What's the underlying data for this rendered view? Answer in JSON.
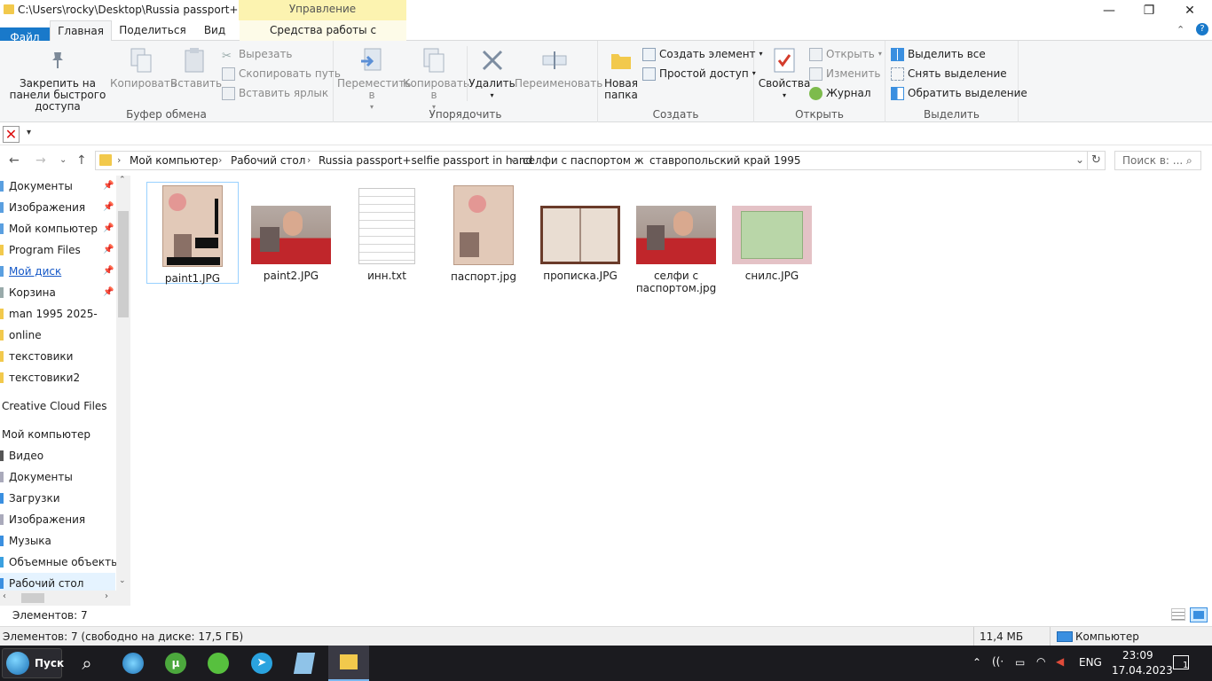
{
  "window": {
    "title": "C:\\Users\\rocky\\Desktop\\Russia passport+self...",
    "context_tab_header": "Управление",
    "minimize": "—",
    "maximize": "❐",
    "close": "✕"
  },
  "tabs": [
    {
      "label": "Файл"
    },
    {
      "label": "Главная"
    },
    {
      "label": "Поделиться"
    },
    {
      "label": "Вид"
    },
    {
      "label": "Средства работы с рисунками"
    }
  ],
  "ribbon": {
    "clipboard": {
      "label": "Буфер обмена",
      "pin": "Закрепить на панели быстрого доступа",
      "copy": "Копировать",
      "paste": "Вставить",
      "cut": "Вырезать",
      "copy_path": "Скопировать путь",
      "paste_shortcut": "Вставить ярлык"
    },
    "organize": {
      "label": "Упорядочить",
      "move_to": "Переместить в",
      "copy_to": "Копировать в",
      "delete": "Удалить",
      "rename": "Переименовать"
    },
    "create": {
      "label": "Создать",
      "new_folder": "Новая папка",
      "new_item": "Создать элемент",
      "easy_access": "Простой доступ"
    },
    "open": {
      "label": "Открыть",
      "properties": "Свойства",
      "open": "Открыть",
      "edit": "Изменить",
      "history": "Журнал"
    },
    "select": {
      "label": "Выделить",
      "select_all": "Выделить все",
      "select_none": "Снять выделение",
      "invert": "Обратить выделение"
    }
  },
  "address": {
    "crumbs": [
      "Мой компьютер",
      "Рабочий стол",
      "Russia passport+selfie passport in hand",
      "селфи с паспортом ж",
      "ставропольский край 1995"
    ],
    "search_placeholder": "Поиск в: ..."
  },
  "nav": [
    {
      "label": "Документы",
      "pinned": true
    },
    {
      "label": "Изображения",
      "pinned": true
    },
    {
      "label": "Мой компьютер",
      "pinned": true
    },
    {
      "label": "Program Files",
      "pinned": true
    },
    {
      "label": "Мой диск",
      "pinned": true
    },
    {
      "label": "Корзина",
      "pinned": true
    },
    {
      "label": "man 1995 2025-",
      "pinned": false
    },
    {
      "label": "online",
      "pinned": false
    },
    {
      "label": "текстовики",
      "pinned": false
    },
    {
      "label": "текстовики2",
      "pinned": false
    },
    {
      "label": "Creative Cloud Files",
      "pinned": false
    },
    {
      "label": "Мой компьютер",
      "pinned": false
    },
    {
      "label": "Видео",
      "pinned": false
    },
    {
      "label": "Документы",
      "pinned": false
    },
    {
      "label": "Загрузки",
      "pinned": false
    },
    {
      "label": "Изображения",
      "pinned": false
    },
    {
      "label": "Музыка",
      "pinned": false
    },
    {
      "label": "Объемные объекты",
      "pinned": false
    },
    {
      "label": "Рабочий стол",
      "pinned": false
    }
  ],
  "files": [
    {
      "name": "paint1.JPG",
      "kind": "passport-open"
    },
    {
      "name": "paint2.JPG",
      "kind": "selfie"
    },
    {
      "name": "инн.txt",
      "kind": "text"
    },
    {
      "name": "паспорт.jpg",
      "kind": "passport-open"
    },
    {
      "name": "прописка.JPG",
      "kind": "passport-spread"
    },
    {
      "name": "селфи с паспортом.jpg",
      "kind": "selfie"
    },
    {
      "name": "снилс.JPG",
      "kind": "green-card"
    }
  ],
  "status": {
    "items": "Элементов: 7",
    "detail": "Элементов: 7 (свободно на диске: 17,5 ГБ)",
    "size": "11,4 МБ",
    "location": "Компьютер"
  },
  "taskbar": {
    "start": "Пуск",
    "lang": "ENG",
    "time": "23:09",
    "date": "17.04.2023",
    "notifications": "1"
  },
  "colors": {
    "accent": "#1979ca",
    "context_tab": "#fcf3b0",
    "selection": "#cce8ff",
    "folder": "#f2c94c",
    "taskbar": "#1b1b1f"
  }
}
